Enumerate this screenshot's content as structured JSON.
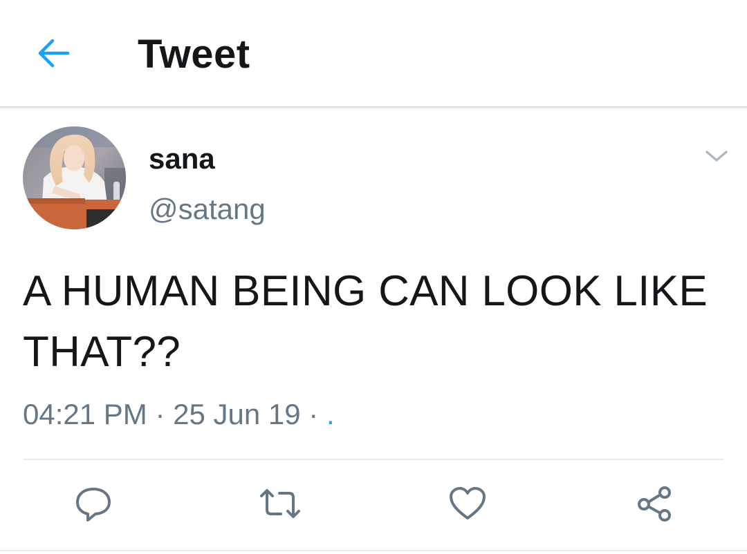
{
  "header": {
    "title": "Tweet",
    "back_icon": "arrow-left-icon",
    "accent_color": "#1da1f2"
  },
  "tweet": {
    "display_name": "sana",
    "handle": "@satang",
    "text": "A HUMAN BEING CAN LOOK LIKE THAT??",
    "time": "04:21 PM",
    "date": "25 Jun 19",
    "separator": "·",
    "via": ".",
    "avatar_icon": "user-avatar-photo",
    "caret_icon": "chevron-down-icon"
  },
  "actions": [
    {
      "name": "reply",
      "icon": "comment-icon"
    },
    {
      "name": "retweet",
      "icon": "retweet-icon"
    },
    {
      "name": "like",
      "icon": "heart-icon"
    },
    {
      "name": "share",
      "icon": "share-icon"
    }
  ],
  "colors": {
    "text_primary": "#14171a",
    "text_secondary": "#657786",
    "accent": "#1da1f2",
    "divider": "#e6ecf0"
  }
}
